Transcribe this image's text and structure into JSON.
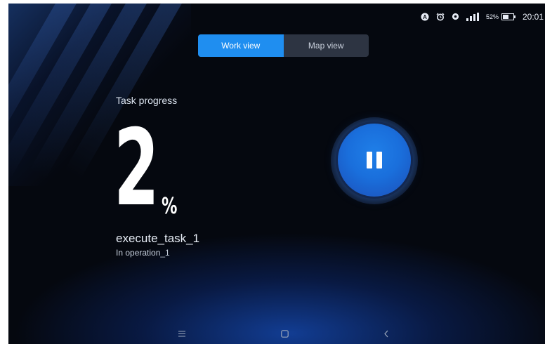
{
  "status_bar": {
    "battery_percent": "52%",
    "time": "20:01",
    "icons": [
      "a-badge-icon",
      "alarm-icon",
      "location-icon",
      "signal-icon",
      "battery-icon"
    ]
  },
  "view_toggle": {
    "options": [
      {
        "label": "Work view",
        "selected": true
      },
      {
        "label": "Map view",
        "selected": false
      }
    ]
  },
  "task": {
    "heading": "Task progress",
    "progress_value": "2",
    "progress_unit": "%",
    "name": "execute_task_1",
    "status": "In operation_1"
  },
  "controls": {
    "pause_icon": "pause-icon"
  },
  "nav_bar": {
    "icons": [
      "menu-icon",
      "home-icon",
      "back-icon"
    ]
  },
  "colors": {
    "accent": "#1f8ef0",
    "background": "#05080f",
    "glow": "#1446aa"
  }
}
